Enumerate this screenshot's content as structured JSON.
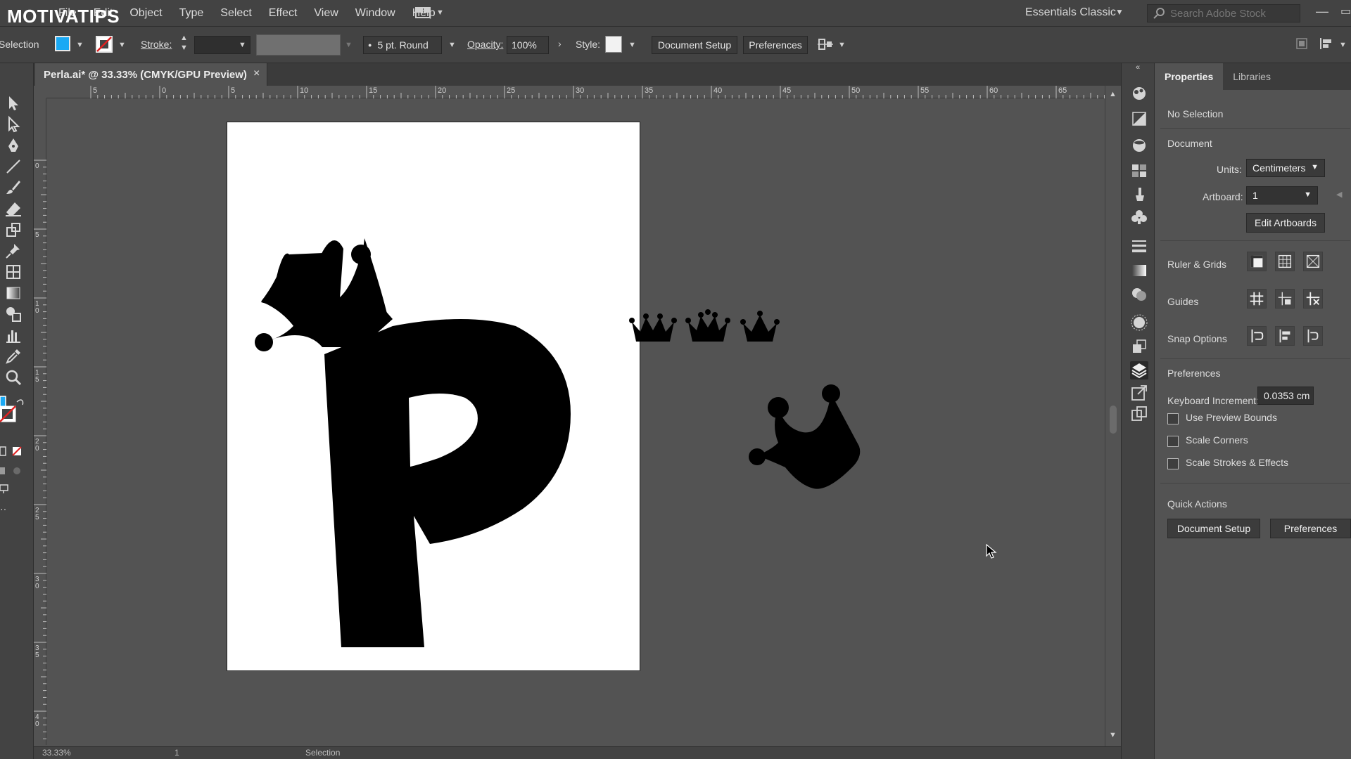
{
  "watermark": "MOTIVATIPS",
  "menu": [
    "File",
    "Edit",
    "Object",
    "Type",
    "Select",
    "Effect",
    "View",
    "Window",
    "Help"
  ],
  "workspace": {
    "label": "Essentials Classic"
  },
  "search": {
    "placeholder": "Search Adobe Stock"
  },
  "control": {
    "selection_label": "Selection",
    "stroke_label": "Stroke:",
    "brush_value": "5 pt. Round",
    "opacity_label": "Opacity:",
    "opacity_value": "100%",
    "style_label": "Style:",
    "document_setup": "Document Setup",
    "preferences": "Preferences"
  },
  "document": {
    "tab_title": "Perla.ai* @ 33.33% (CMYK/GPU Preview)",
    "close": "×"
  },
  "ruler": {
    "top_ticks": [
      "5",
      "0",
      "5",
      "10",
      "15",
      "20",
      "25",
      "30",
      "35",
      "40",
      "45",
      "50",
      "55",
      "60",
      "65"
    ],
    "left_ticks": [
      "0",
      "5",
      "10",
      "15",
      "20",
      "25",
      "30",
      "35",
      "40"
    ]
  },
  "status": {
    "zoom": "33.33%",
    "artboard": "1",
    "tool": "Selection"
  },
  "properties": {
    "tabs": [
      "Properties",
      "Libraries"
    ],
    "no_selection": "No Selection",
    "document_heading": "Document",
    "units_label": "Units:",
    "units_value": "Centimeters",
    "artboard_label": "Artboard:",
    "artboard_value": "1",
    "edit_artboards": "Edit Artboards",
    "ruler_grids": "Ruler & Grids",
    "guides": "Guides",
    "snap_options": "Snap Options",
    "preferences_heading": "Preferences",
    "keyboard_increment_label": "Keyboard Increment:",
    "keyboard_increment_value": "0.0353 cm",
    "use_preview_bounds": "Use Preview Bounds",
    "scale_corners": "Scale Corners",
    "scale_strokes": "Scale Strokes & Effects",
    "quick_actions": "Quick Actions",
    "qa_document_setup": "Document Setup",
    "qa_preferences": "Preferences"
  },
  "colors": {
    "fill": "#1aa9f4",
    "chrome": "#434343",
    "canvas": "#535353",
    "artboard": "#ffffff"
  }
}
